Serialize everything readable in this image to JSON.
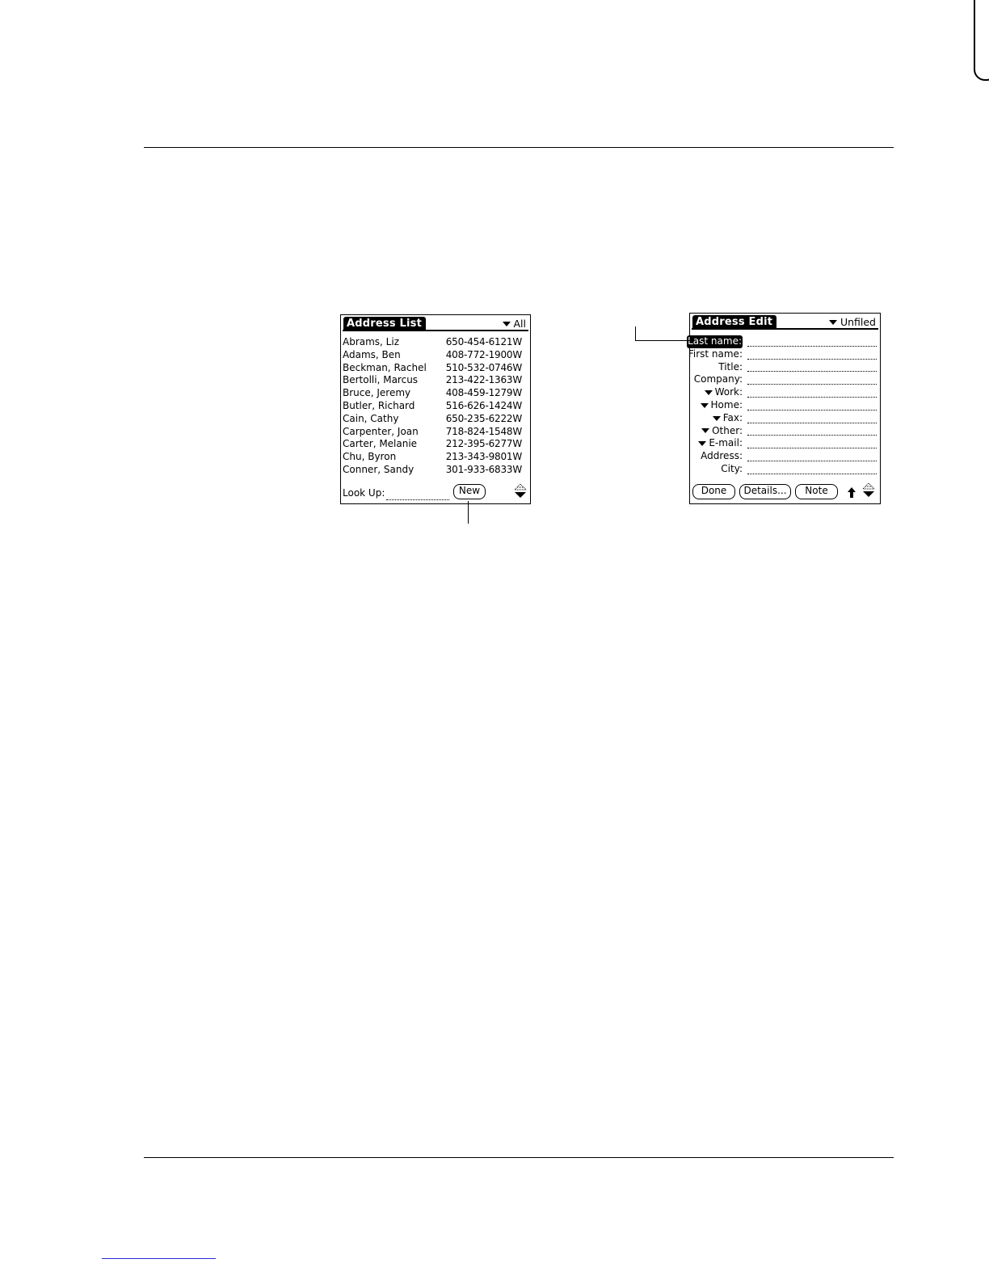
{
  "address_list": {
    "title": "Address List",
    "category": "All",
    "entries": [
      {
        "name": "Abrams, Liz",
        "phone": "650-454-6121",
        "type": "W"
      },
      {
        "name": "Adams, Ben",
        "phone": "408-772-1900",
        "type": "W"
      },
      {
        "name": "Beckman, Rachel",
        "phone": "510-532-0746",
        "type": "W"
      },
      {
        "name": "Bertolli, Marcus",
        "phone": "213-422-1363",
        "type": "W"
      },
      {
        "name": "Bruce, Jeremy",
        "phone": "408-459-1279",
        "type": "W"
      },
      {
        "name": "Butler, Richard",
        "phone": "516-626-1424",
        "type": "W"
      },
      {
        "name": "Cain, Cathy",
        "phone": "650-235-6222",
        "type": "W"
      },
      {
        "name": "Carpenter, Joan",
        "phone": "718-824-1548",
        "type": "W"
      },
      {
        "name": "Carter, Melanie",
        "phone": "212-395-6277",
        "type": "W"
      },
      {
        "name": "Chu, Byron",
        "phone": "213-343-9801",
        "type": "W"
      },
      {
        "name": "Conner, Sandy",
        "phone": "301-933-6833",
        "type": "W"
      }
    ],
    "lookup_label": "Look Up:",
    "lookup_value": "",
    "new_button": "New"
  },
  "address_edit": {
    "title": "Address Edit",
    "category": "Unfiled",
    "fields": [
      {
        "label": "Last name:",
        "value": "",
        "dropdown": false,
        "selected": true
      },
      {
        "label": "First name:",
        "value": "",
        "dropdown": false,
        "selected": false
      },
      {
        "label": "Title:",
        "value": "",
        "dropdown": false,
        "selected": false
      },
      {
        "label": "Company:",
        "value": "",
        "dropdown": false,
        "selected": false
      },
      {
        "label": "Work:",
        "value": "",
        "dropdown": true,
        "selected": false
      },
      {
        "label": "Home:",
        "value": "",
        "dropdown": true,
        "selected": false
      },
      {
        "label": "Fax:",
        "value": "",
        "dropdown": true,
        "selected": false
      },
      {
        "label": "Other:",
        "value": "",
        "dropdown": true,
        "selected": false
      },
      {
        "label": "E-mail:",
        "value": "",
        "dropdown": true,
        "selected": false
      },
      {
        "label": "Address:",
        "value": "",
        "dropdown": false,
        "selected": false
      },
      {
        "label": "City:",
        "value": "",
        "dropdown": false,
        "selected": false
      }
    ],
    "done_button": "Done",
    "details_button": "Details...",
    "note_button": "Note"
  }
}
